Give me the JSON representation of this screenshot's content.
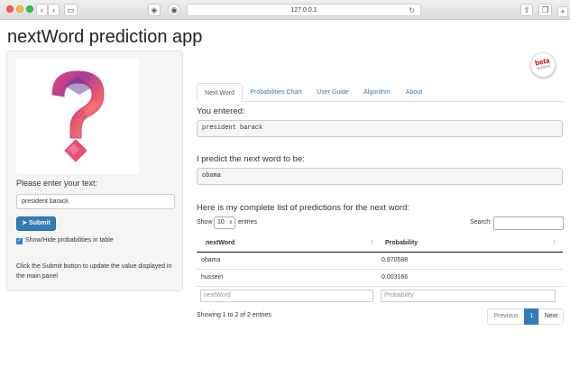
{
  "browser": {
    "url": "127.0.0.1"
  },
  "app": {
    "title": "nextWord prediction app"
  },
  "sidebar": {
    "prompt_label": "Please enter your text:",
    "text_value": "president barack",
    "submit_label": "Submit",
    "checkbox_label": "Show/Hide probabilities in table",
    "help_text": "Click the Submit button to update the value displayed in the main panel"
  },
  "badge": {
    "text": "beta",
    "sub": "version"
  },
  "tabs": [
    "Next Word",
    "Probabilities Chart",
    "User Guide",
    "Algorithm",
    "About"
  ],
  "main": {
    "you_entered_label": "You entered:",
    "entered_value": "president barack",
    "predict_label": "I predict the next word to be:",
    "predicted_value": "obama",
    "list_label": "Here is my complete list of predictions for the next word:"
  },
  "table": {
    "show_label": "Show",
    "entries_value": "10",
    "entries_label": "entries",
    "search_label": "Search:",
    "columns": [
      "nextWord",
      "Probability"
    ],
    "rows": [
      {
        "word": "obama",
        "prob": "0.970588"
      },
      {
        "word": "hussein",
        "prob": "0.003166"
      }
    ],
    "filter_placeholders": [
      "nextWord",
      "Probability"
    ],
    "info": "Showing 1 to 2 of 2 entries",
    "pagination": {
      "previous": "Previous",
      "page": "1",
      "next": "Next"
    }
  },
  "colors": {
    "primary": "#337ab7",
    "checkbox": "#2d7fd3"
  }
}
